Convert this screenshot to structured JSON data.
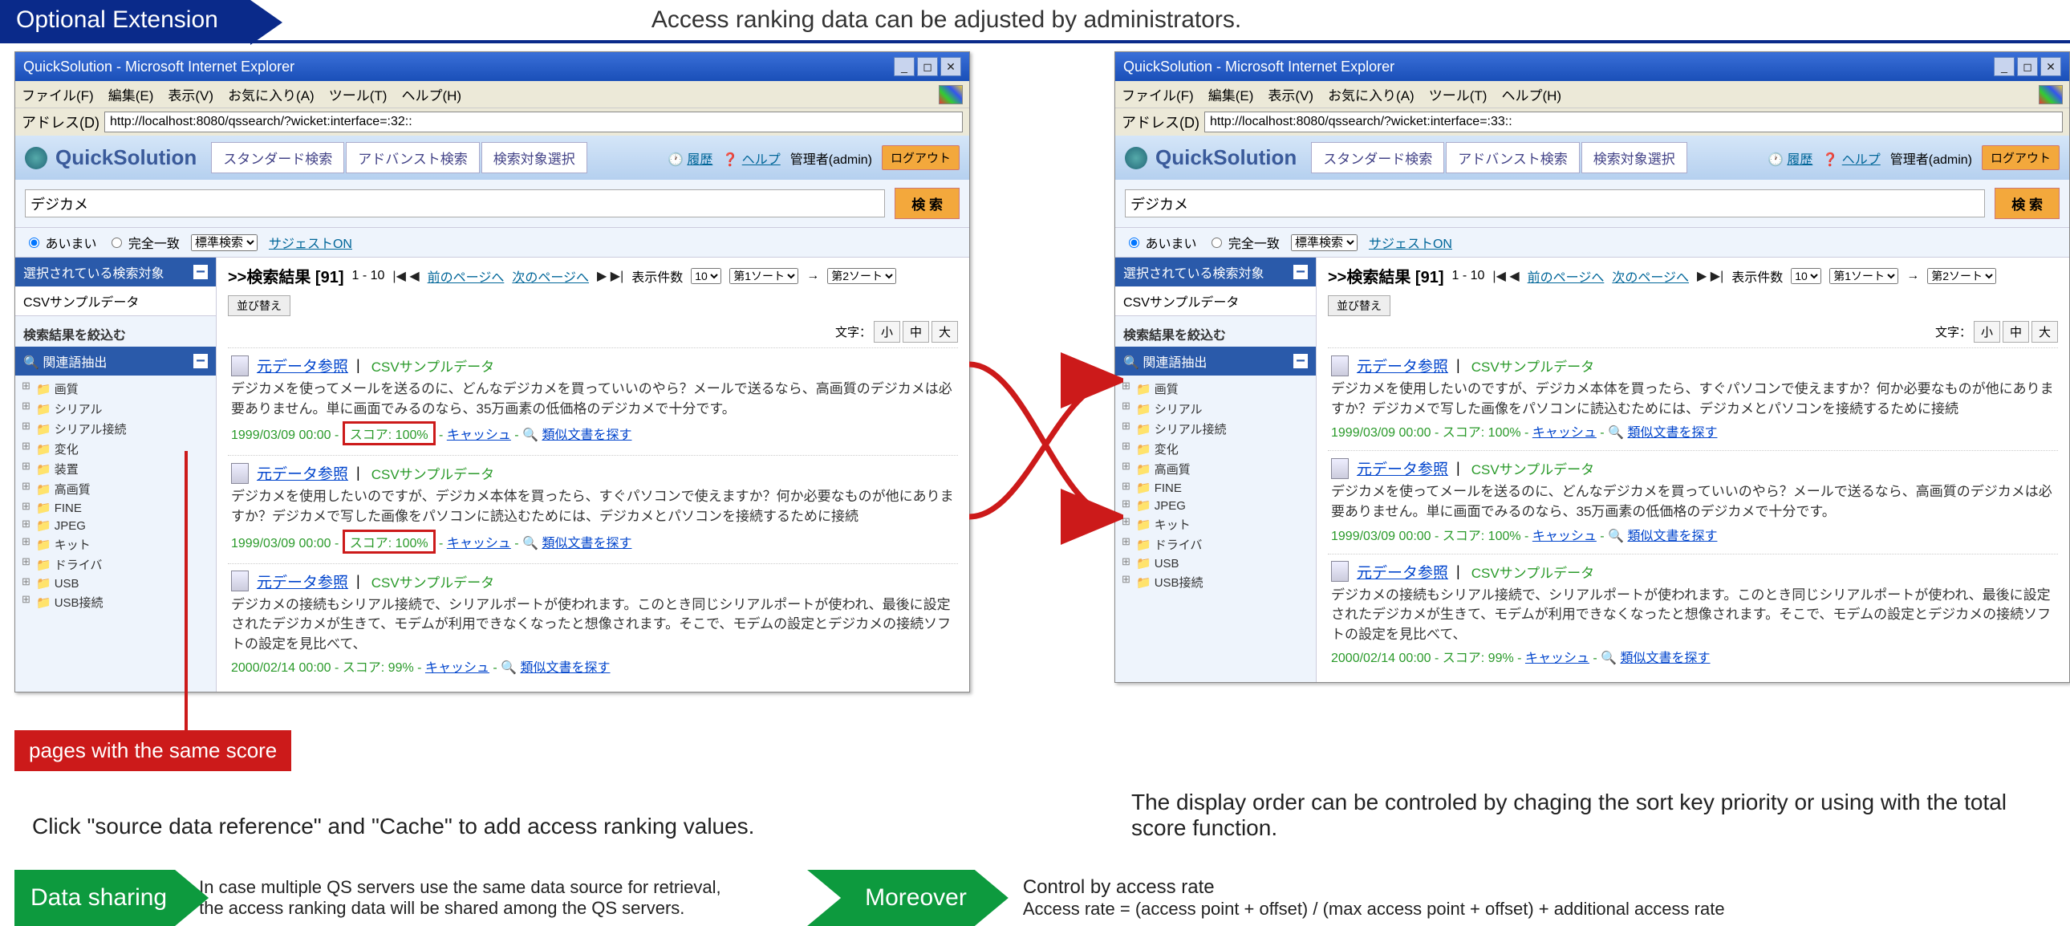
{
  "header": {
    "badge": "Optional Extension",
    "headline": "Access ranking data can be adjusted by administrators."
  },
  "browser": {
    "title": "QuickSolution - Microsoft Internet Explorer",
    "menu": [
      "ファイル(F)",
      "編集(E)",
      "表示(V)",
      "お気に入り(A)",
      "ツール(T)",
      "ヘルプ(H)"
    ],
    "address_label": "アドレス(D)",
    "url1": "http://localhost:8080/qssearch/?wicket:interface=:32::",
    "url2": "http://localhost:8080/qssearch/?wicket:interface=:33::"
  },
  "qs": {
    "logo": "QuickSolution",
    "tabs": [
      "スタンダード検索",
      "アドバンスト検索",
      "検索対象選択"
    ],
    "hist": "履歴",
    "help": "ヘルプ",
    "admin": "管理者(admin)",
    "logout": "ログアウト",
    "query": "デジカメ",
    "search": "検 索",
    "opt_fuzzy": "あいまい",
    "opt_exact": "完全一致",
    "opt_mode": "標準検索",
    "suggest": "サジェストON"
  },
  "sidebar": {
    "sel_head": "選択されている検索対象",
    "sel_val": "CSVサンプルデータ",
    "refine": "検索結果を絞込む",
    "related": "関連語抽出",
    "tree1": [
      "画質",
      "シリアル",
      "シリアル接続",
      "変化",
      "装置",
      "高画質",
      "FINE",
      "JPEG",
      "キット",
      "ドライバ",
      "USB",
      "USB接続"
    ],
    "tree2": [
      "画質",
      "シリアル",
      "シリアル接続",
      "変化",
      "高画質",
      "FINE",
      "JPEG",
      "キット",
      "ドライバ",
      "USB",
      "USB接続"
    ]
  },
  "resultsHeader": {
    "label": "検索結果",
    "count": "[91]",
    "range": "1 - 10",
    "prev": "前のページへ",
    "next": "次のページへ",
    "per_lbl": "表示件数",
    "per_val": "10",
    "sort1": "第1ソート",
    "sort2": "第2ソート",
    "reorder": "並び替え",
    "text_lbl": "文字：",
    "small": "小",
    "mid": "中",
    "large": "大"
  },
  "r": {
    "title": "元データ参照",
    "src": "CSVサンプルデータ",
    "snip_a": "デジカメを使ってメールを送るのに、どんなデジカメを買っていいのやら？メールで送るなら、高画質のデジカメは必要ありません。単に画面でみるのなら、35万画素の低価格のデジカメで十分です。",
    "snip_b": "デジカメを使用したいのですが、デジカメ本体を買ったら、すぐパソコンで使えますか？何か必要なものが他にありますか？デジカメで写した画像をパソコンに読込むためには、デジカメとパソコンを接続するために接続",
    "snip_c": "デジカメの接続もシリアル接続で、シリアルポートが使われます。このとき同じシリアルポートが使われ、最後に設定されたデジカメが生きて、モデムが利用できなくなったと想像されます。そこで、モデムの設定とデジカメの接続ソフトの設定を見比べて、",
    "date1": "1999/03/09 00:00",
    "date2": "2000/02/14 00:00",
    "score100_boxed": "スコア: 100%",
    "score100": "- スコア: 100% -",
    "score99": "- スコア: 99% -",
    "cache": "キャッシュ",
    "mag": "🔍",
    "sim": "類似文書を探す"
  },
  "callout": {
    "same_score": "pages with the same score"
  },
  "captions": {
    "c1": "Click \"source data reference\" and \"Cache\" to add access ranking values.",
    "c2": "The display order can be controled by chaging the sort key priority or using with the total score function."
  },
  "bottom": {
    "g1": "Data sharing",
    "p1a": "In case multiple QS servers use the same data source for retrieval,",
    "p1b": "the access ranking data will be  shared among the QS servers.",
    "g2": "Moreover",
    "p2a": "Control by access rate",
    "p2b": "Access rate = (access point + offset) / (max access point + offset) + additional access rate"
  }
}
